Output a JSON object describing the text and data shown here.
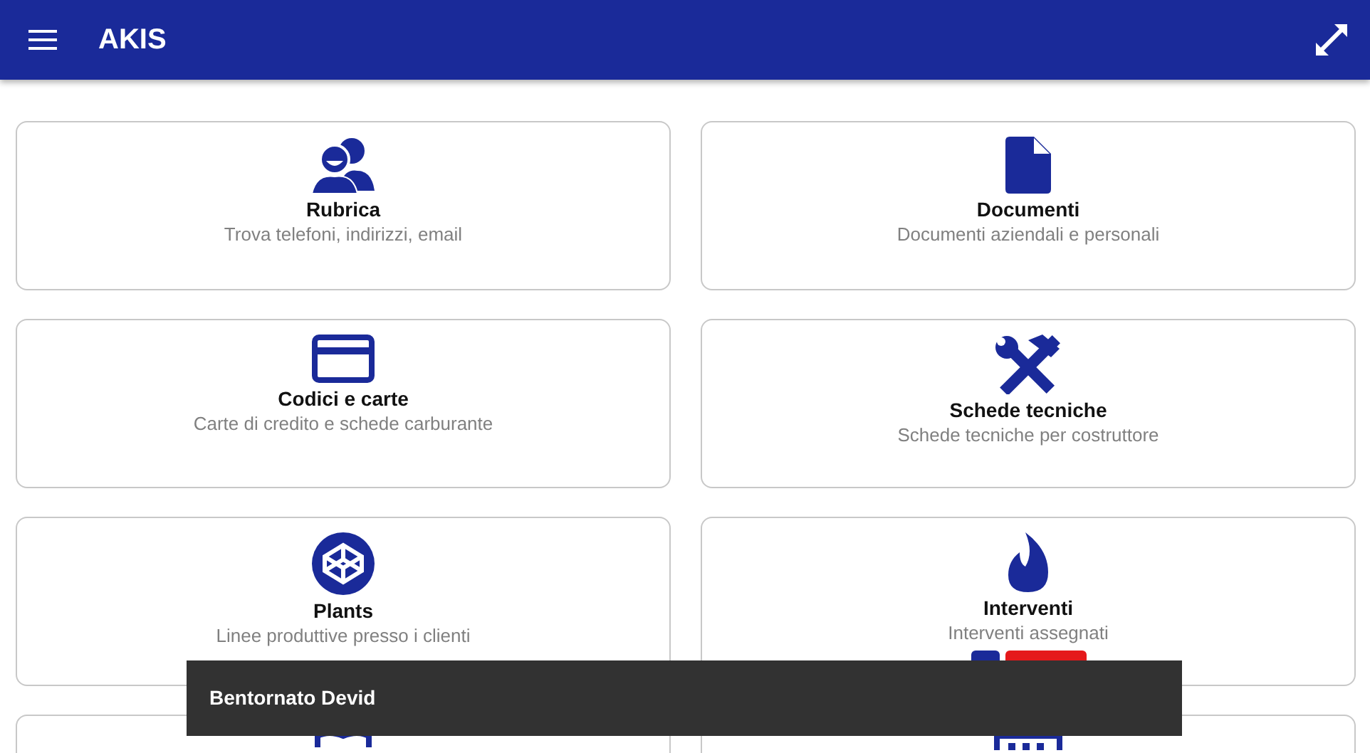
{
  "app_bar": {
    "title": "AKIS"
  },
  "tiles": [
    {
      "kind": "people",
      "title": "Rubrica",
      "subtitle": "Trova telefoni, indirizzi, email"
    },
    {
      "kind": "document",
      "title": "Documenti",
      "subtitle": "Documenti aziendali e personali"
    },
    {
      "kind": "card",
      "title": "Codici e carte",
      "subtitle": "Carte di credito e schede carburante"
    },
    {
      "kind": "tools",
      "title": "Schede tecniche",
      "subtitle": "Schede tecniche per costruttore"
    },
    {
      "kind": "cube",
      "title": "Plants",
      "subtitle": "Linee produttive presso i clienti"
    },
    {
      "kind": "fire",
      "title": "Interventi",
      "subtitle": "Interventi assegnati",
      "badges": [
        {
          "color": "#1a2a99"
        },
        {
          "color": "#e5191b"
        }
      ]
    },
    {
      "kind": "book"
    },
    {
      "kind": "calendar"
    }
  ],
  "snackbar": {
    "message": "Bentornato Devid"
  }
}
